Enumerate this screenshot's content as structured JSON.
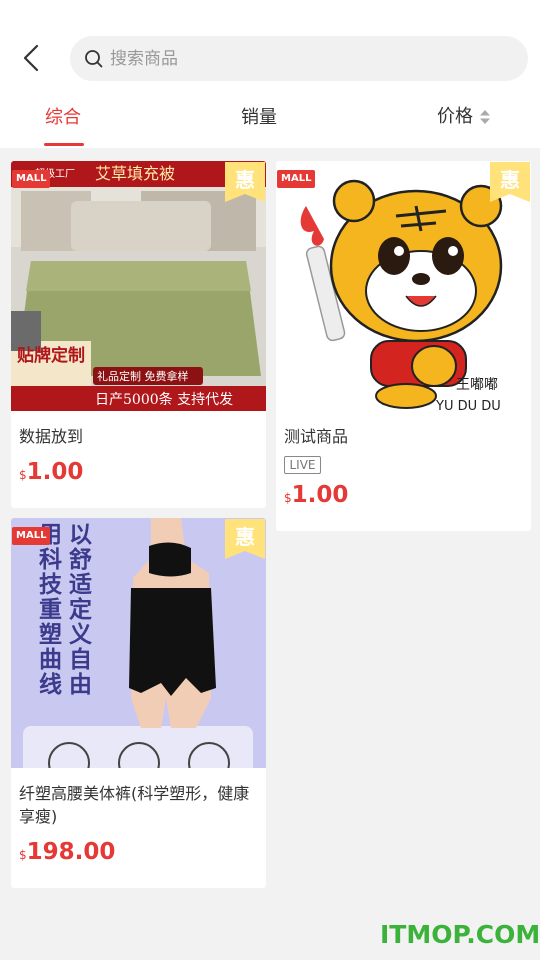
{
  "search": {
    "placeholder": "搜索商品"
  },
  "tabs": [
    {
      "label": "综合",
      "active": true
    },
    {
      "label": "销量",
      "active": false
    },
    {
      "label": "价格",
      "active": false
    }
  ],
  "colors": {
    "accent": "#e53935",
    "price": "#e53935",
    "watermark": "#3bb33b"
  },
  "products": [
    {
      "title": "数据放到",
      "currency": "$",
      "price": "1.00",
      "mall_badge": "MALL",
      "promo_badge": "惠",
      "image_text": {
        "top": "艾草填充被",
        "corner": "超级工厂",
        "side": "贴牌定制",
        "ribbon": "礼品定制 免费拿样",
        "bottom": "日产5000条 支持代发"
      }
    },
    {
      "title": "测试商品",
      "live_label": "LIVE",
      "currency": "$",
      "price": "1.00",
      "mall_badge": "MALL",
      "promo_badge": "惠",
      "image_text": {
        "name_cn": "王嘟嘟",
        "name_en": "YU DU DU"
      }
    },
    {
      "title": "纤塑高腰美体裤(科学塑形，健康享瘦)",
      "currency": "$",
      "price": "198.00",
      "mall_badge": "MALL",
      "promo_badge": "惠",
      "image_text": {
        "col1": "用科技重塑曲线",
        "col2": "以舒适定义自由"
      }
    }
  ],
  "watermark": "ITMOP.COM"
}
